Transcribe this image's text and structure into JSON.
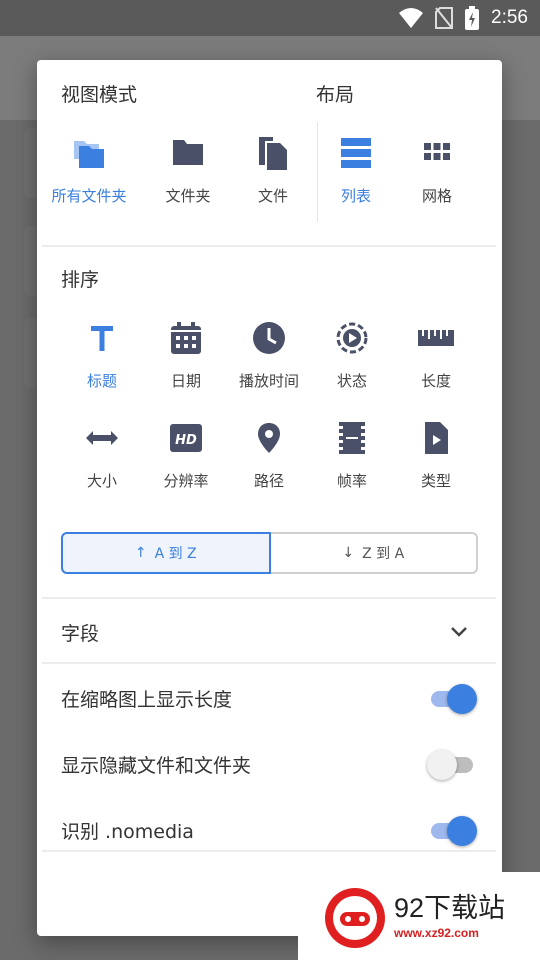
{
  "status_bar": {
    "time": "2:56"
  },
  "view_mode": {
    "title": "视图模式",
    "options": [
      {
        "label": "所有文件夹",
        "icon": "folders-icon",
        "active": true
      },
      {
        "label": "文件夹",
        "icon": "folder-icon",
        "active": false
      },
      {
        "label": "文件",
        "icon": "files-icon",
        "active": false
      }
    ]
  },
  "layout": {
    "title": "布局",
    "options": [
      {
        "label": "列表",
        "icon": "list-icon",
        "active": true
      },
      {
        "label": "网格",
        "icon": "grid-icon",
        "active": false
      }
    ]
  },
  "sort": {
    "title": "排序",
    "options": [
      {
        "label": "标题",
        "icon": "title-icon",
        "active": true
      },
      {
        "label": "日期",
        "icon": "calendar-icon",
        "active": false
      },
      {
        "label": "播放时间",
        "icon": "clock-icon",
        "active": false
      },
      {
        "label": "状态",
        "icon": "status-icon",
        "active": false
      },
      {
        "label": "长度",
        "icon": "ruler-icon",
        "active": false
      },
      {
        "label": "大小",
        "icon": "size-icon",
        "active": false
      },
      {
        "label": "分辨率",
        "icon": "hd-icon",
        "active": false
      },
      {
        "label": "路径",
        "icon": "location-icon",
        "active": false
      },
      {
        "label": "帧率",
        "icon": "film-icon",
        "active": false
      },
      {
        "label": "类型",
        "icon": "file-type-icon",
        "active": false
      }
    ],
    "order": {
      "asc": "A 到 Z",
      "desc": "Z 到 A",
      "selected": "asc"
    }
  },
  "fields": {
    "title": "字段"
  },
  "settings": [
    {
      "label": "在缩略图上显示长度",
      "on": true
    },
    {
      "label": "显示隐藏文件和文件夹",
      "on": false
    },
    {
      "label": "识别 .nomedia",
      "on": true
    }
  ],
  "watermark": {
    "text": "92下载站",
    "url": "www.xz92.com"
  },
  "colors": {
    "accent": "#3b7fe0",
    "icon": "#4a5068",
    "text": "#333333"
  }
}
